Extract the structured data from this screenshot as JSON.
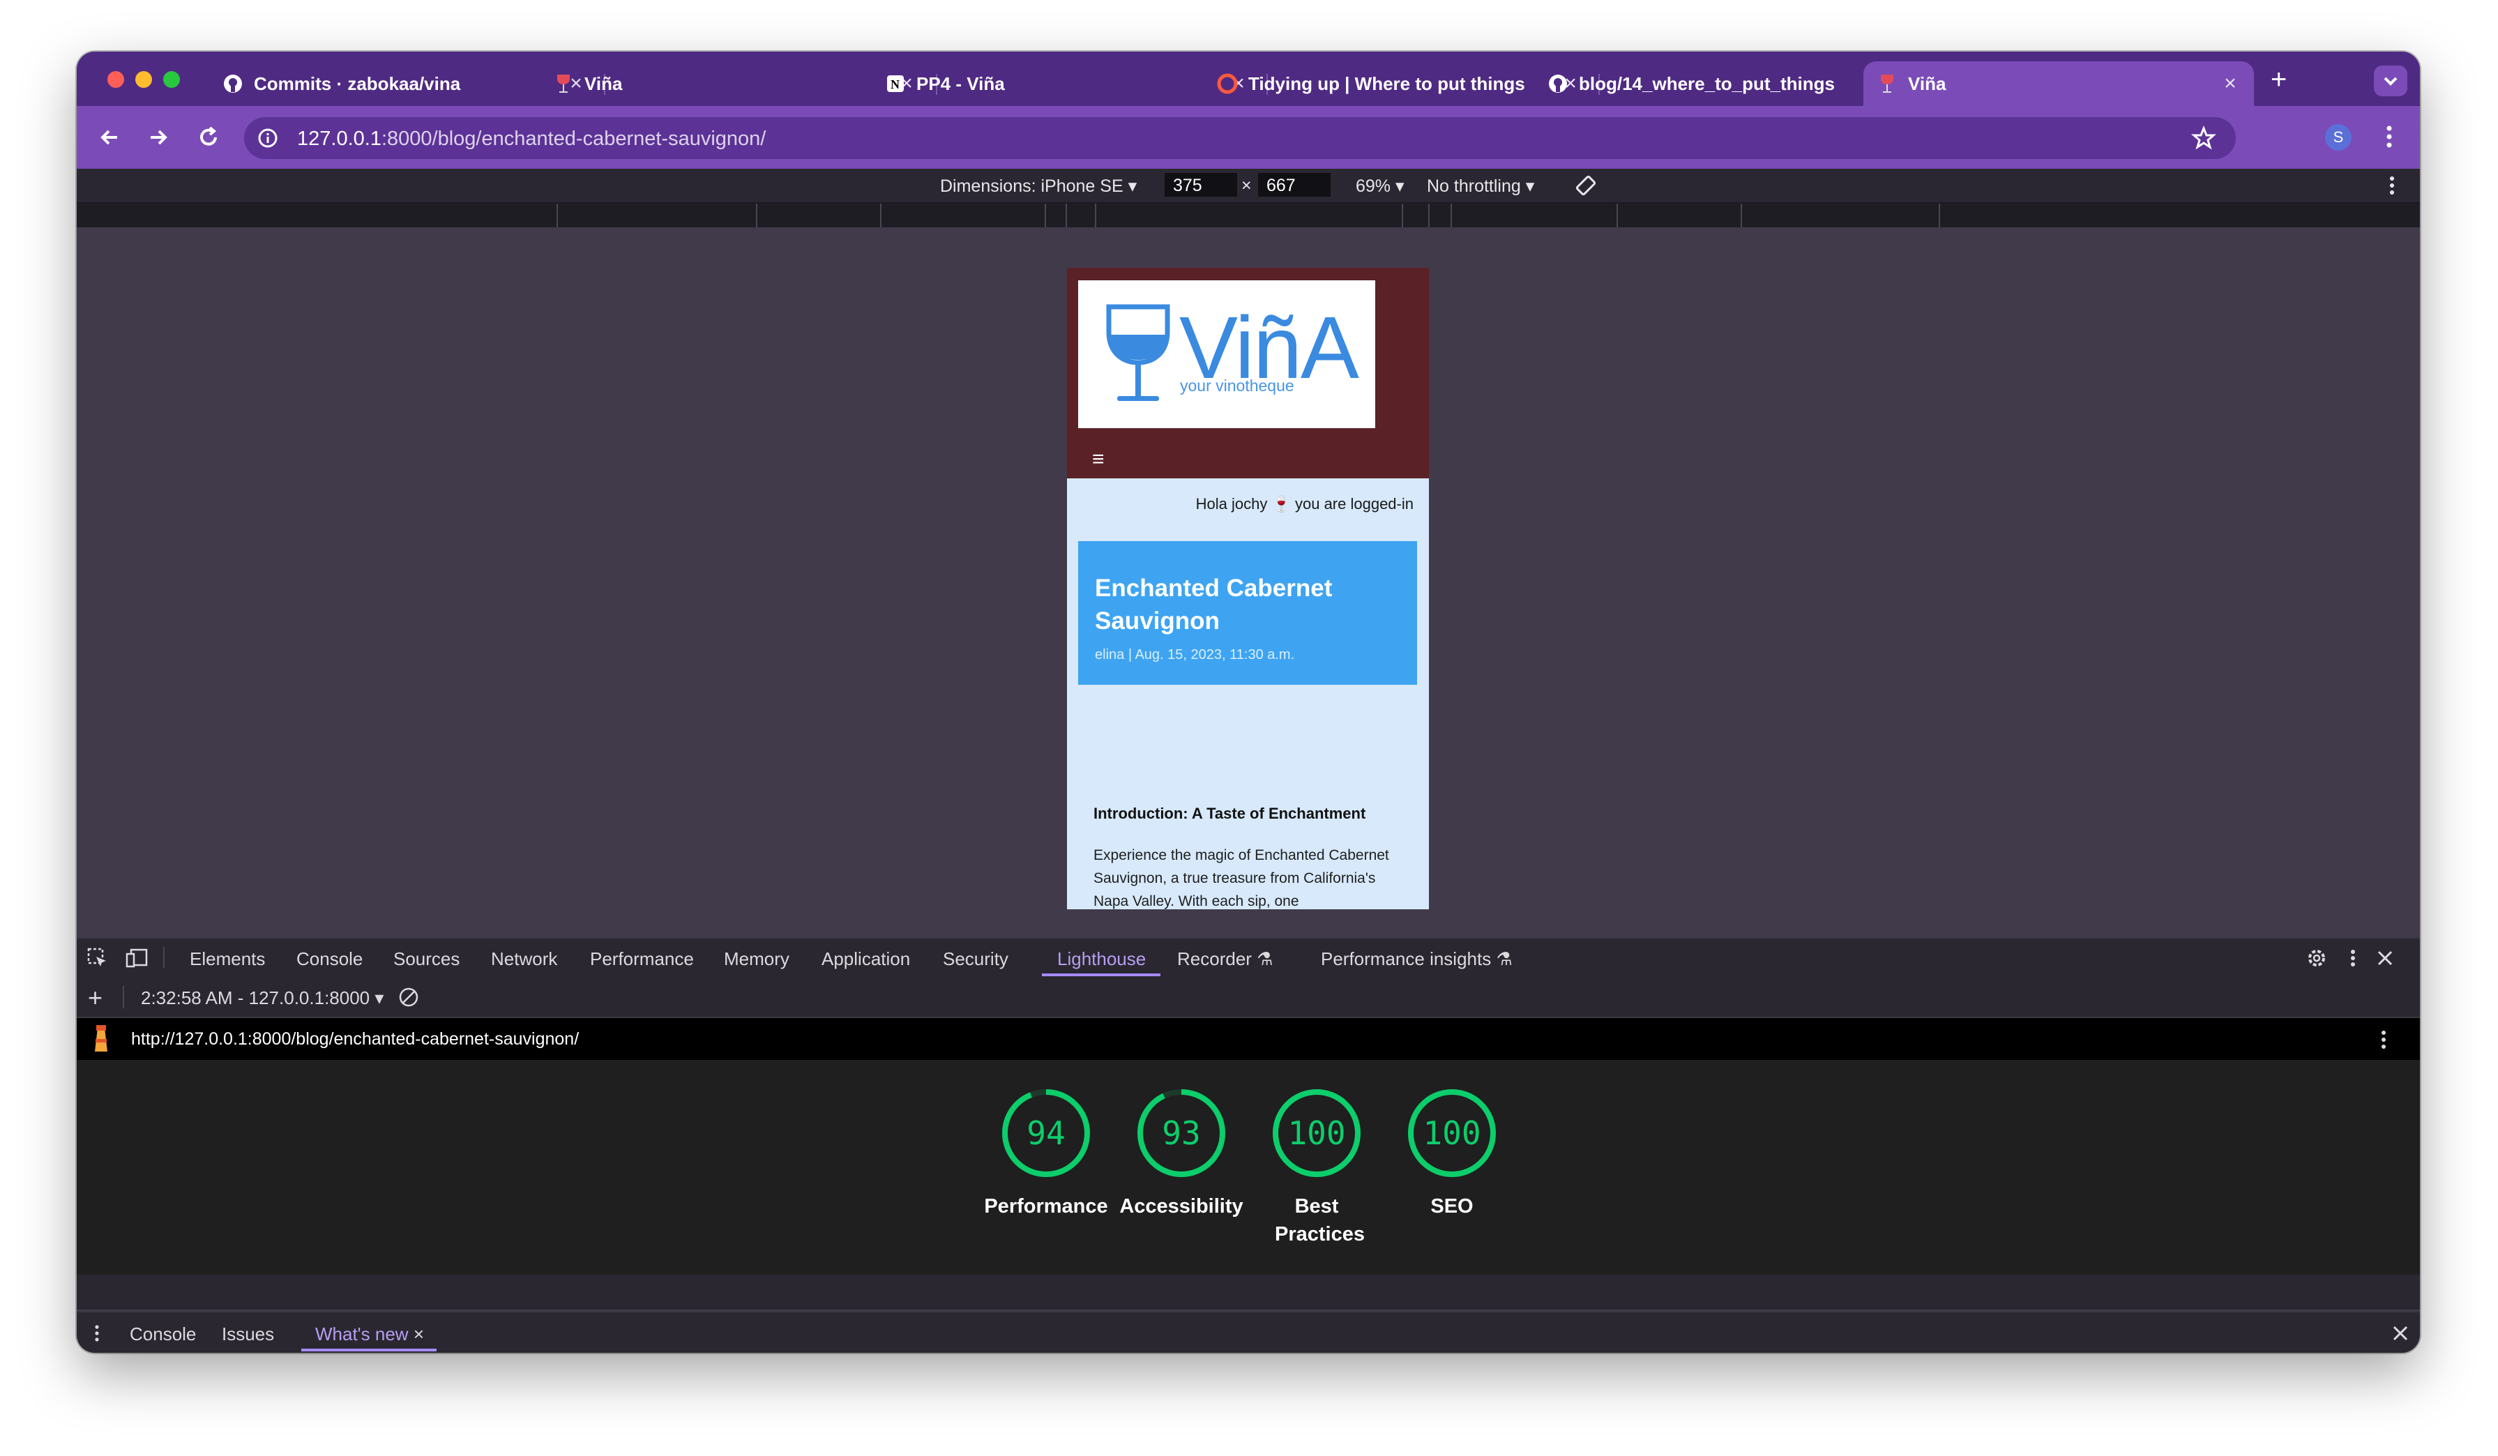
{
  "browser": {
    "tabs": [
      {
        "title": "Commits · zabokaa/vina",
        "icon": "github-icon"
      },
      {
        "title": "Viña",
        "icon": "wine-glass-icon"
      },
      {
        "title": "PP4 - Viña",
        "icon": "notion-icon"
      },
      {
        "title": "Tidying up | Where to put things",
        "icon": "tidying-icon"
      },
      {
        "title": "blog/14_where_to_put_things",
        "icon": "github-icon"
      },
      {
        "title": "Viña",
        "icon": "wine-glass-icon"
      }
    ],
    "active_tab_index": 5,
    "new_tab_label": "+",
    "url_host": "127.0.0.1",
    "url_rest": ":8000/blog/enchanted-cabernet-sauvignon/",
    "profile_initial": "S"
  },
  "device_toolbar": {
    "dimensions_label": "Dimensions: iPhone SE",
    "width": "375",
    "times": "×",
    "height": "667",
    "zoom": "69%",
    "throttling": "No throttling"
  },
  "site": {
    "logo_text": "ViñA",
    "logo_tagline": "your vinotheque",
    "menu_icon": "≡",
    "greeting": "Hola jochy 🍷 you are logged-in",
    "post_title": "Enchanted Cabernet Sauvignon",
    "post_meta": "elina | Aug. 15, 2023, 11:30 a.m.",
    "section_heading": "Introduction: A Taste of Enchantment",
    "body_text": "Experience the magic of Enchanted Cabernet Sauvignon, a true treasure from California's Napa Valley. With each sip, one"
  },
  "devtools": {
    "tabs": [
      "Elements",
      "Console",
      "Sources",
      "Network",
      "Performance",
      "Memory",
      "Application",
      "Security",
      "Lighthouse",
      "Recorder",
      "Performance insights"
    ],
    "active_tab": "Lighthouse",
    "report_selector": "2:32:58 AM - 127.0.0.1:8000",
    "report_url": "http://127.0.0.1:8000/blog/enchanted-cabernet-sauvignon/",
    "scores": [
      {
        "label": "Performance",
        "value": 94
      },
      {
        "label": "Accessibility",
        "value": 93
      },
      {
        "label": "Best Practices",
        "value": 100
      },
      {
        "label": "SEO",
        "value": 100
      }
    ],
    "score_color": "#0cce6b",
    "drawer_tabs": [
      "Console",
      "Issues",
      "What's new"
    ],
    "drawer_active": "What's new"
  }
}
